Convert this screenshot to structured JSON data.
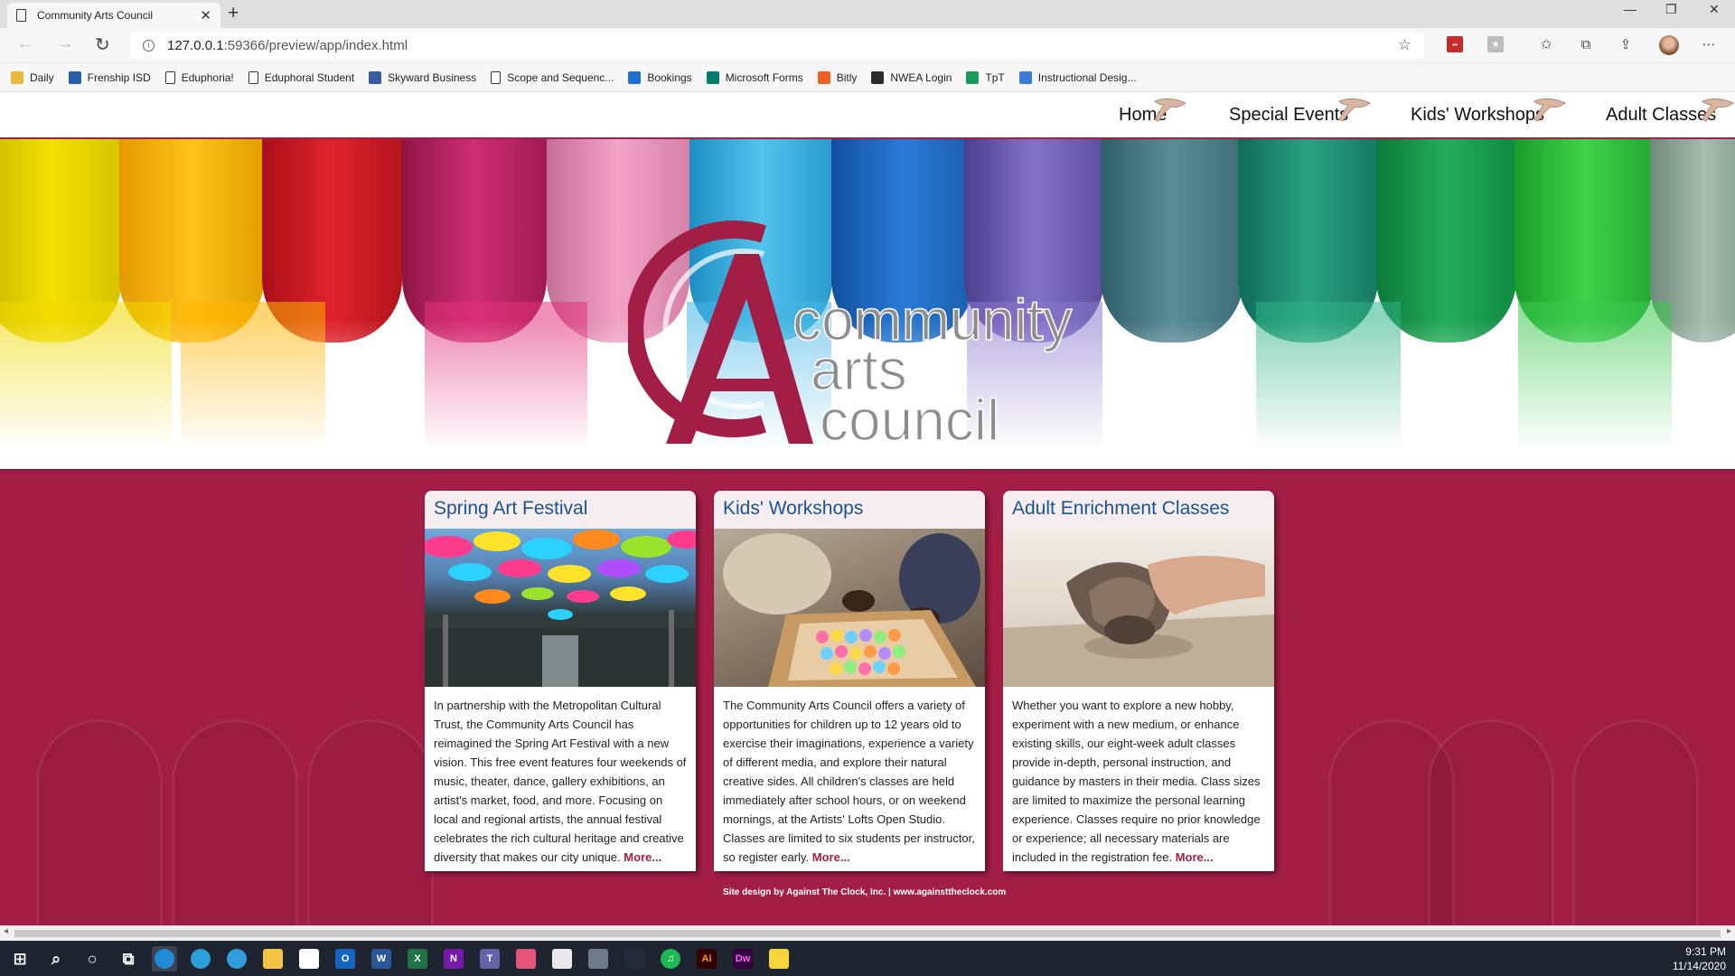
{
  "browser": {
    "tab_title": "Community Arts Council",
    "url_host": "127.0.0.1",
    "url_rest": ":59366/preview/app/index.html",
    "bookmarks": [
      {
        "label": "Daily",
        "icon": "folder-icon",
        "color": "#e8b93b"
      },
      {
        "label": "Frenship ISD",
        "icon": "frenship-icon",
        "color": "#2a5ba8"
      },
      {
        "label": "Eduphoria!",
        "icon": "page-icon",
        "color": "#ffffff"
      },
      {
        "label": "Eduphoral Student",
        "icon": "page-icon",
        "color": "#ffffff"
      },
      {
        "label": "Skyward Business",
        "icon": "skyward-icon",
        "color": "#3a5aa0"
      },
      {
        "label": "Scope and Sequenc...",
        "icon": "page-icon",
        "color": "#ffffff"
      },
      {
        "label": "Bookings",
        "icon": "bookings-icon",
        "color": "#1f6fd1"
      },
      {
        "label": "Microsoft Forms",
        "icon": "forms-icon",
        "color": "#037c6e"
      },
      {
        "label": "Bitly",
        "icon": "bitly-icon",
        "color": "#ee6123"
      },
      {
        "label": "NWEA Login",
        "icon": "nwea-icon",
        "color": "#2b2b2b"
      },
      {
        "label": "TpT",
        "icon": "tpt-icon",
        "color": "#1a9b5a"
      },
      {
        "label": "Instructional Desig...",
        "icon": "info-pin-icon",
        "color": "#3a7bd5"
      }
    ]
  },
  "site": {
    "nav": [
      "Home",
      "Special Events",
      "Kids' Workshops",
      "Adult Classes"
    ],
    "logo": {
      "line1": "community",
      "line2": "arts",
      "line3": "council"
    },
    "cards": [
      {
        "title": "Spring Art Festival",
        "image": "umbrella-canopy-photo",
        "text": "In partnership with the Metropolitan Cultural Trust, the Community Arts Council has reimagined the Spring Art Festival with a new vision. This free event features four weekends of music, theater, dance, gallery exhibitions, an artist's market, food, and more. Focusing on local and regional artists, the annual festival celebrates the rich cultural heritage and creative diversity that makes our city unique.",
        "more": "More..."
      },
      {
        "title": "Kids' Workshops",
        "image": "kids-chalk-photo",
        "text": "The Community Arts Council offers a variety of opportunities for children up to 12 years old to exercise their imaginations, experience a variety of different media, and explore their natural creative sides. All children's classes are held immediately after school hours, or on weekend mornings, at the Artists' Lofts Open Studio. Classes are limited to six students per instructor, so register early.",
        "more": "More..."
      },
      {
        "title": "Adult Enrichment Classes",
        "image": "clay-hands-photo",
        "text": "Whether you want to explore a new hobby, experiment with a new medium, or enhance existing skills, our eight-week adult classes provide in-depth, personal instruction, and guidance by masters in their media. Class sizes are limited to maximize the personal learning experience. Classes require no prior knowledge or experience; all necessary materials are included in the registration fee.",
        "more": "More..."
      }
    ],
    "footer": "Site design by Against The Clock, Inc. | www.againsttheclock.com",
    "colors": {
      "brand": "#a31e45",
      "link": "#1b5391"
    }
  },
  "taskbar": {
    "time": "9:31 PM",
    "date": "11/14/2020",
    "apps": [
      "windows-start-icon",
      "search-icon",
      "cortana-icon",
      "task-view-icon",
      "edge-dev-icon",
      "edge-beta-icon",
      "edge-icon",
      "file-explorer-icon",
      "store-icon",
      "outlook-icon",
      "word-icon",
      "excel-icon",
      "onenote-icon",
      "teams-icon",
      "photos-icon",
      "notepad-icon",
      "calculator-icon",
      "kindle-icon",
      "spotify-icon",
      "illustrator-icon",
      "dreamweaver-icon",
      "sticky-notes-icon"
    ]
  }
}
